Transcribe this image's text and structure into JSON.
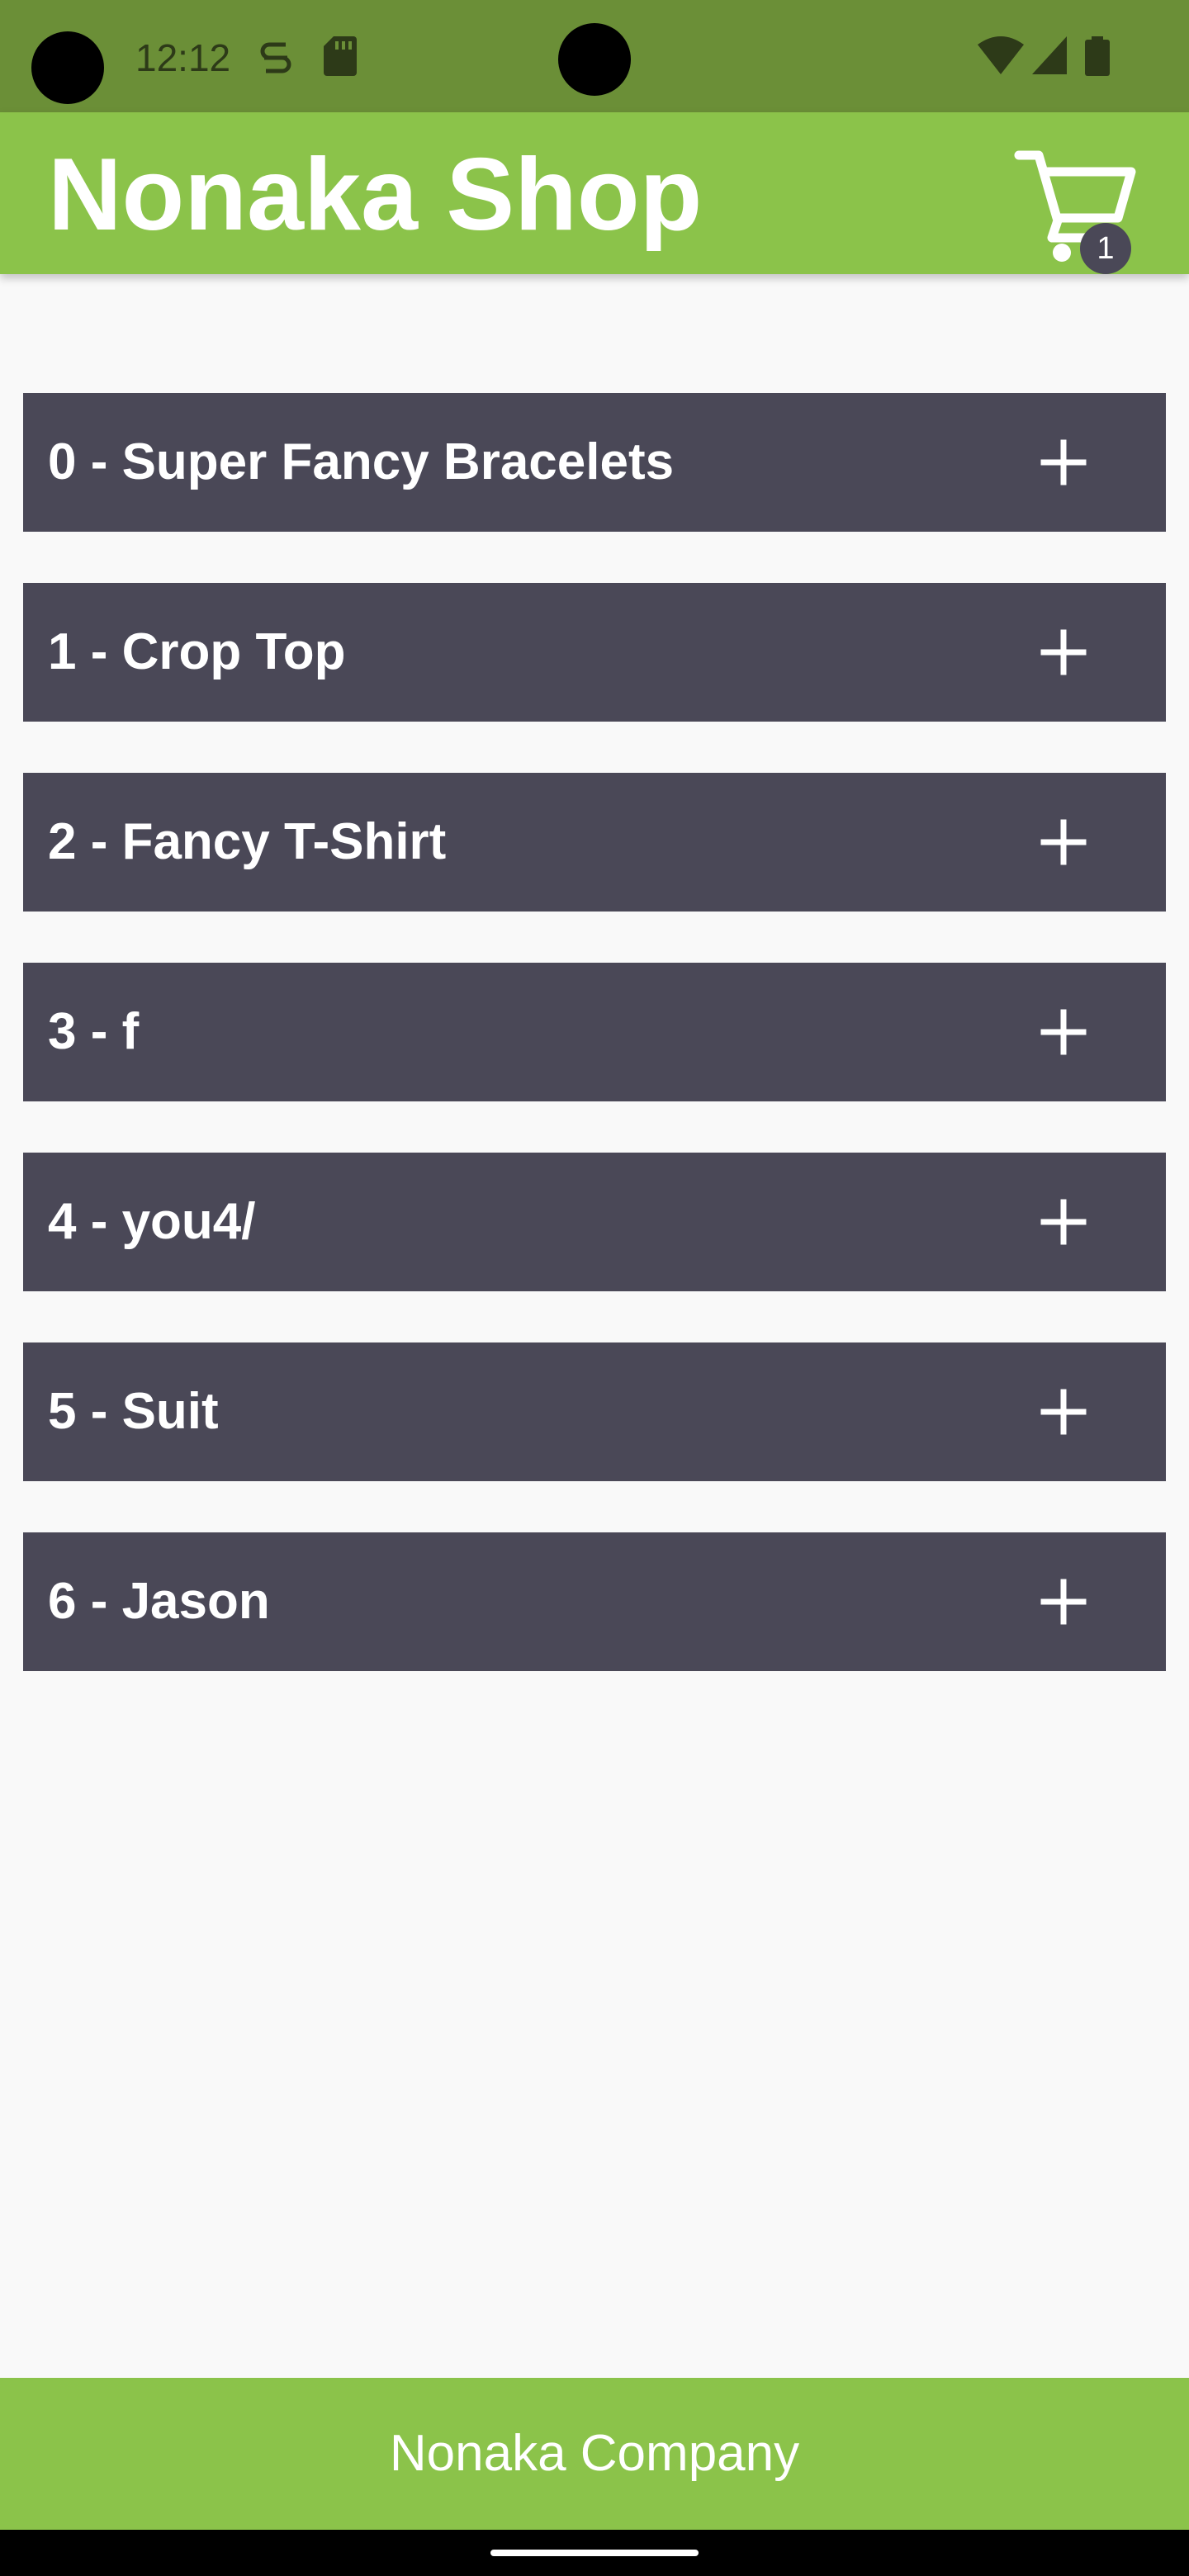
{
  "status_bar": {
    "time": "12:12",
    "icons": [
      "sync-icon",
      "sd-card-icon",
      "wifi-icon",
      "signal-icon",
      "battery-icon"
    ]
  },
  "app_bar": {
    "title": "Nonaka Shop",
    "cart_icon": "shopping-cart-icon",
    "cart_count": "1"
  },
  "products": [
    {
      "label": "0 - Super Fancy Bracelets",
      "action_icon": "plus-icon"
    },
    {
      "label": "1 - Crop Top",
      "action_icon": "plus-icon"
    },
    {
      "label": "2 - Fancy T-Shirt",
      "action_icon": "plus-icon"
    },
    {
      "label": "3 - f",
      "action_icon": "plus-icon"
    },
    {
      "label": "4 - you4/",
      "action_icon": "plus-icon"
    },
    {
      "label": "5 - Suit",
      "action_icon": "plus-icon"
    },
    {
      "label": "6 - Jason",
      "action_icon": "plus-icon"
    }
  ],
  "footer": {
    "text": "Nonaka Company"
  },
  "colors": {
    "status_bar": "#6b8f37",
    "primary": "#8bc34a",
    "item_background": "#4a4857",
    "page_background": "#f9f9f9",
    "text_on_primary": "#ffffff"
  }
}
